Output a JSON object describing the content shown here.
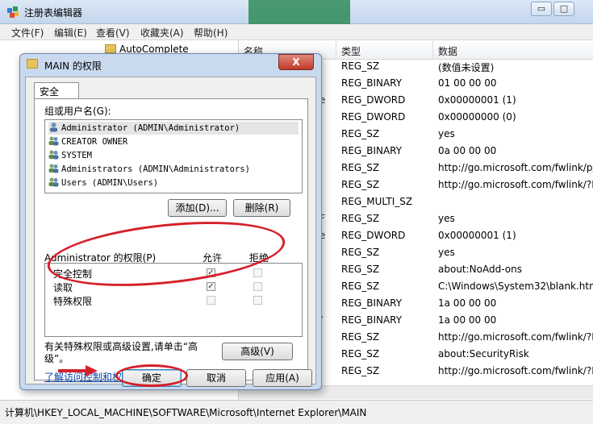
{
  "app": {
    "title": "注册表编辑器",
    "window_buttons": [
      "▭",
      "□"
    ]
  },
  "menu": [
    "文件(F)",
    "编辑(E)",
    "查看(V)",
    "收藏夹(A)",
    "帮助(H)"
  ],
  "tree": {
    "item": "AutoComplete"
  },
  "list": {
    "columns": [
      "名称",
      "类型",
      "数据"
    ],
    "rows": [
      {
        "cut": "",
        "type": "REG_SZ",
        "data": "(数值未设置)"
      },
      {
        "cut": "",
        "type": "REG_BINARY",
        "data": "01 00 00 00"
      },
      {
        "cut": "e",
        "type": "REG_DWORD",
        "data": "0x00000001 (1)"
      },
      {
        "cut": "i",
        "type": "REG_DWORD",
        "data": "0x00000000 (0)"
      },
      {
        "cut": "",
        "type": "REG_SZ",
        "data": "yes"
      },
      {
        "cut": "",
        "type": "REG_BINARY",
        "data": "0a 00 00 00"
      },
      {
        "cut": "",
        "type": "REG_SZ",
        "data": "http://go.microsoft.com/fwlink/p/"
      },
      {
        "cut": "",
        "type": "REG_SZ",
        "data": "http://go.microsoft.com/fwlink/?L"
      },
      {
        "cut": "",
        "type": "REG_MULTI_SZ",
        "data": ""
      },
      {
        "cut": "F",
        "type": "REG_SZ",
        "data": "yes"
      },
      {
        "cut": "e",
        "type": "REG_DWORD",
        "data": "0x00000001 (1)"
      },
      {
        "cut": "",
        "type": "REG_SZ",
        "data": "yes"
      },
      {
        "cut": "",
        "type": "REG_SZ",
        "data": "about:NoAdd-ons"
      },
      {
        "cut": "",
        "type": "REG_SZ",
        "data": "C:\\Windows\\System32\\blank.htm"
      },
      {
        "cut": "",
        "type": "REG_BINARY",
        "data": "1a 00 00 00"
      },
      {
        "cut": "/",
        "type": "REG_BINARY",
        "data": "1a 00 00 00"
      },
      {
        "cut": "",
        "type": "REG_SZ",
        "data": "http://go.microsoft.com/fwlink/?L"
      },
      {
        "cut": "",
        "type": "REG_SZ",
        "data": "about:SecurityRisk"
      },
      {
        "cut": "",
        "type": "REG_SZ",
        "data": "http://go.microsoft.com/fwlink/?L"
      }
    ]
  },
  "status": "计算机\\HKEY_LOCAL_MACHINE\\SOFTWARE\\Microsoft\\Internet Explorer\\MAIN",
  "dialog": {
    "title": "MAIN 的权限",
    "close": "X",
    "tab": "安全",
    "group_label": "组或用户名(G):",
    "users": [
      "Administrator (ADMIN\\Administrator)",
      "CREATOR OWNER",
      "SYSTEM",
      "Administrators (ADMIN\\Administrators)",
      "Users (ADMIN\\Users)"
    ],
    "add_button": "添加(D)...",
    "remove_button": "删除(R)",
    "perm_label": "Administrator 的权限(P)",
    "allow_label": "允许",
    "deny_label": "拒绝",
    "permissions": [
      {
        "name": "完全控制",
        "allow": true,
        "deny": false
      },
      {
        "name": "读取",
        "allow": true,
        "deny": false
      },
      {
        "name": "特殊权限",
        "allow": false,
        "deny": false
      }
    ],
    "advanced_text": "有关特殊权限或高级设置,请单击“高级”。",
    "advanced_button": "高级(V)",
    "learn_link": "了解访问控制和权限",
    "ok": "确定",
    "cancel": "取消",
    "apply": "应用(A)"
  },
  "colors": {
    "annotation": "#d6202a",
    "link": "#0645ad"
  }
}
